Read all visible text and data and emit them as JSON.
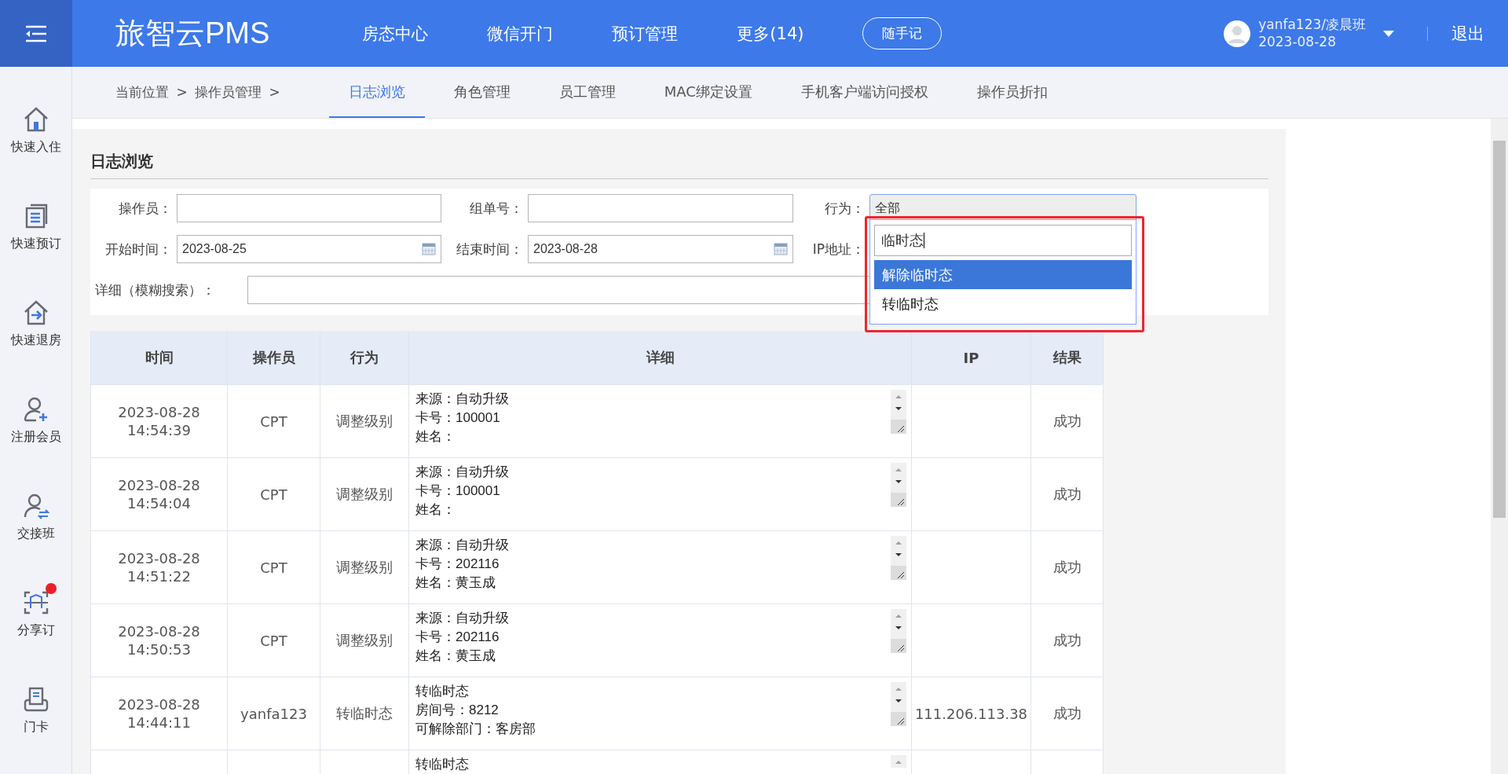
{
  "top_bar": {
    "logo": "旅智云PMS",
    "nav": [
      "房态中心",
      "微信开门",
      "预订管理",
      "更多(14)"
    ],
    "note_button": "随手记",
    "user": "yanfa123/凌晨班",
    "date": "2023-08-28",
    "logout": "退出"
  },
  "sidebar": {
    "items": [
      {
        "label": "快速入住",
        "kind": "home",
        "badge": false
      },
      {
        "label": "快速预订",
        "kind": "doc",
        "badge": false
      },
      {
        "label": "快速退房",
        "kind": "checkout",
        "badge": false
      },
      {
        "label": "注册会员",
        "kind": "adduser",
        "badge": false
      },
      {
        "label": "交接班",
        "kind": "swapuser",
        "badge": false
      },
      {
        "label": "分享订",
        "kind": "scan",
        "badge": true
      },
      {
        "label": "门卡",
        "kind": "card",
        "badge": false
      }
    ]
  },
  "breadcrumb": "当前位置 > 操作员管理 >",
  "tabs": [
    {
      "label": "日志浏览",
      "selected": true
    },
    {
      "label": "角色管理",
      "selected": false
    },
    {
      "label": "员工管理",
      "selected": false
    },
    {
      "label": "MAC绑定设置",
      "selected": false
    },
    {
      "label": "手机客户端访问授权",
      "selected": false
    },
    {
      "label": "操作员折扣",
      "selected": false
    }
  ],
  "panel": {
    "title": "日志浏览",
    "filters": [
      {
        "label": "操作员：",
        "kind": "text"
      },
      {
        "label": "组单号：",
        "kind": "text"
      },
      {
        "label": "行为：",
        "kind": "select",
        "value": "全部"
      },
      {
        "label": "开始时间：",
        "kind": "date",
        "value": "2023-08-25"
      },
      {
        "label": "结束时间：",
        "kind": "date",
        "value": "2023-08-28"
      },
      {
        "label": "IP地址：",
        "kind": "text"
      },
      {
        "label": "详细（模糊搜索）：",
        "kind": "wide"
      }
    ],
    "dropdown": {
      "search": "临时态",
      "options": [
        {
          "label": "解除临时态",
          "selected": true
        },
        {
          "label": "转临时态",
          "selected": false
        }
      ]
    }
  },
  "table": {
    "columns": [
      "时间",
      "操作员",
      "行为",
      "详细",
      "IP",
      "结果"
    ],
    "rows": [
      {
        "date": "2023-08-28",
        "time": "14:54:39",
        "operator": "CPT",
        "action": "调整级别",
        "detail": [
          "来源：自动升级",
          "卡号：100001",
          "姓名："
        ],
        "ip": "",
        "result": "成功"
      },
      {
        "date": "2023-08-28",
        "time": "14:54:04",
        "operator": "CPT",
        "action": "调整级别",
        "detail": [
          "来源：自动升级",
          "卡号：100001",
          "姓名："
        ],
        "result": "成功"
      },
      {
        "date": "2023-08-28",
        "time": "14:51:22",
        "operator": "CPT",
        "action": "调整级别",
        "detail": [
          "来源：自动升级",
          "卡号：202116",
          "姓名：黄玉成"
        ],
        "result": "成功"
      },
      {
        "date": "2023-08-28",
        "time": "14:50:53",
        "operator": "CPT",
        "action": "调整级别",
        "detail": [
          "来源：自动升级",
          "卡号：202116",
          "姓名：黄玉成"
        ],
        "result": "成功"
      },
      {
        "date": "2023-08-28",
        "time": "14:44:11",
        "operator": "yanfa123",
        "action": "转临时态",
        "detail": [
          "转临时态",
          "房间号：8212",
          "可解除部门：客房部"
        ],
        "ip": "111.206.113.38",
        "result": "成功"
      },
      {
        "detail": [
          "转临时态"
        ]
      }
    ]
  }
}
